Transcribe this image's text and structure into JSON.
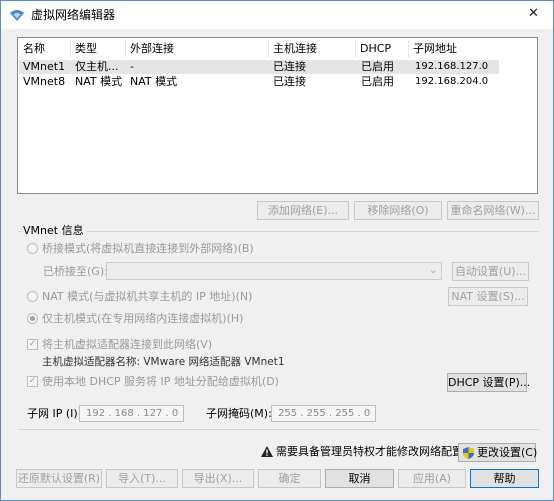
{
  "window": {
    "title": "虚拟网络编辑器",
    "close_glyph": "✕"
  },
  "table": {
    "headers": [
      "名称",
      "类型",
      "外部连接",
      "主机连接",
      "DHCP",
      "子网地址"
    ],
    "rows": [
      [
        "VMnet1",
        "仅主机...",
        "-",
        "已连接",
        "已启用",
        "192.168.127.0"
      ],
      [
        "VMnet8",
        "NAT 模式",
        "NAT 模式",
        "已连接",
        "已启用",
        "192.168.204.0"
      ]
    ]
  },
  "list_buttons": {
    "add": "添加网络(E)...",
    "remove": "移除网络(O)",
    "rename": "重命名网络(W)..."
  },
  "vmnet_info": {
    "group_label": "VMnet 信息",
    "bridged": "桥接模式(将虚拟机直接连接到外部网络)(B)",
    "bridged_to": "已桥接至(G):",
    "auto_settings": "自动设置(U)...",
    "nat": "NAT 模式(与虚拟机共享主机的 IP 地址)(N)",
    "nat_settings": "NAT 设置(S)...",
    "host_only": "仅主机模式(在专用网络内连接虚拟机)(H)",
    "connect_adapter": "将主机虚拟适配器连接到此网络(V)",
    "adapter_name": "主机虚拟适配器名称: VMware 网络适配器 VMnet1",
    "use_dhcp": "使用本地 DHCP 服务将 IP 地址分配给虚拟机(D)",
    "dhcp_settings": "DHCP 设置(P)...",
    "subnet_ip_label": "子网 IP (I):",
    "subnet_ip": "192 . 168 . 127 . 0",
    "mask_label": "子网掩码(M):",
    "mask": "255 . 255 . 255 . 0"
  },
  "admin_notice": "需要具备管理员特权才能修改网络配置。",
  "change_settings": "更改设置(C)",
  "bottom_buttons": {
    "restore": "还原默认设置(R)",
    "import": "导入(T)...",
    "export": "导出(X)...",
    "ok": "确定",
    "cancel": "取消",
    "apply": "应用(A)",
    "help": "帮助"
  },
  "colors": {
    "selected_row": "#e5e5e5",
    "accent": "#0078d7"
  }
}
